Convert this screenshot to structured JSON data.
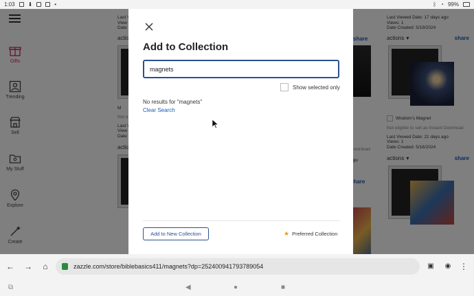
{
  "status_bar": {
    "time": "1:03",
    "battery": "99%"
  },
  "sidebar": {
    "items": [
      {
        "label": "Gifts"
      },
      {
        "label": "Trending"
      },
      {
        "label": "Sell"
      },
      {
        "label": "My Stuff"
      },
      {
        "label": "Explore"
      },
      {
        "label": "Create"
      }
    ]
  },
  "background": {
    "cards": [
      {
        "lines": [
          "Last V",
          "View",
          "Date"
        ],
        "actions": "actio",
        "share": "share",
        "title": "M",
        "note": "Not e",
        "lines2": [
          "Last V",
          "View",
          "Date"
        ],
        "actions2": "actio"
      },
      {
        "lines": [
          "Last Viewed Date: 17 days ago",
          "Views: 1",
          "Date Created: 5/19/2024"
        ],
        "actions": "actions",
        "share": "share",
        "title": "Wisdom's Magnet",
        "note": "Not eligible to sell as Instant Download",
        "lines2": [
          "Last Viewed Date: 21 days ago",
          "Views: 1",
          "Date Created: 5/16/2024"
        ],
        "actions2": "actions",
        "share2": "share"
      },
      {
        "share": "share",
        "note": "Download",
        "lines2": [
          "ago"
        ],
        "share2": "share"
      }
    ]
  },
  "modal": {
    "title": "Add to Collection",
    "search_value": "magnets",
    "show_selected_label": "Show selected only",
    "no_results": "No results for \"magnets\"",
    "clear_search": "Clear Search",
    "add_new_label": "Add to New Collection",
    "preferred_label": "Preferred Collection"
  },
  "browser": {
    "url": "zazzle.com/store/biblebasics411/magnets?dp=252400941793789054"
  },
  "colors": {
    "accent": "#2a4e93",
    "link": "#1a5bb8",
    "gifts": "#c42a5a",
    "star": "#e89a1a"
  }
}
